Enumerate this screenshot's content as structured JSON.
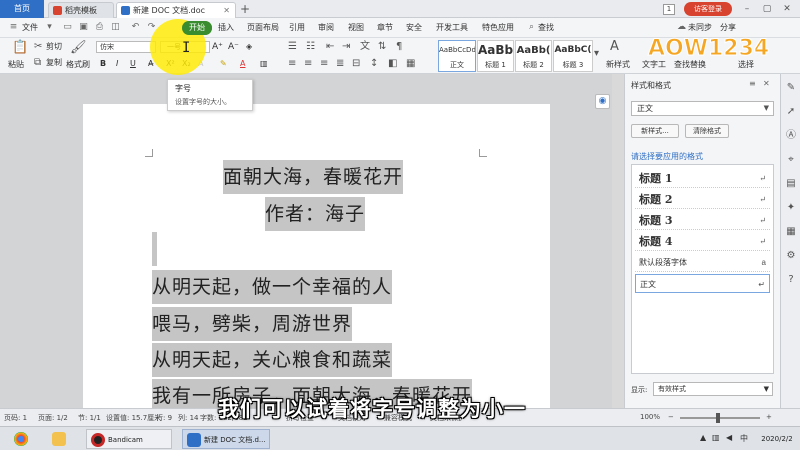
{
  "tabs": {
    "home_label": "首页",
    "items": [
      {
        "label": "稻壳模板",
        "active": false,
        "icon": "wps-logo-icon"
      },
      {
        "label": "新建 DOC 文档.doc",
        "active": true,
        "icon": "writer-doc-icon"
      }
    ],
    "add_label": "+",
    "page_count": "1",
    "login_label": "访客登录"
  },
  "menu": {
    "file_label": "文件",
    "items": [
      "开始",
      "插入",
      "页面布局",
      "引用",
      "审阅",
      "视图",
      "章节",
      "安全",
      "开发工具",
      "特色应用"
    ],
    "active": "开始",
    "search_label": "查找",
    "sync_label": "未同步",
    "share_label": "分享"
  },
  "ribbon": {
    "cut_label": "剪切",
    "copy_label": "复制",
    "format_painter_label": "格式刷",
    "paste_label": "粘贴",
    "font_name": "仿宋",
    "font_size": "一号",
    "bold_label": "B",
    "italic_label": "I",
    "underline_label": "U",
    "styles": [
      {
        "sample": "AaBbCcDd",
        "name": "正文"
      },
      {
        "sample": "AaBb",
        "name": "标题 1"
      },
      {
        "sample": "AaBb(",
        "name": "标题 2"
      },
      {
        "sample": "AaBbC(",
        "name": "标题 3"
      }
    ],
    "new_style_label": "新样式",
    "text_tools_label": "文字工",
    "find_replace_label": "查找替换",
    "select_label": "选择",
    "logo_text": "AOW1234"
  },
  "tooltip": {
    "title": "字号",
    "description": "设置字号的大小。"
  },
  "document": {
    "title": "面朝大海，春暖花开",
    "author": "作者：海子",
    "lines": [
      "从明天起，做一个幸福的人",
      "喂马，劈柴，周游世界",
      "从明天起，关心粮食和蔬菜",
      "我有一所房子，面朝大海，春暖花开"
    ]
  },
  "panel": {
    "title": "样式和格式",
    "current_style": "正文",
    "new_style_button": "新样式...",
    "clear_format_button": "清除格式",
    "apply_label": "请选择要应用的格式",
    "styles": [
      {
        "label": "标题 1",
        "kind": "heading"
      },
      {
        "label": "标题 2",
        "kind": "heading"
      },
      {
        "label": "标题 3",
        "kind": "heading"
      },
      {
        "label": "标题 4",
        "kind": "heading"
      },
      {
        "label": "默认段落字体",
        "kind": "small"
      },
      {
        "label": "正文",
        "kind": "selected"
      }
    ],
    "show_label": "显示:",
    "show_value": "有效样式"
  },
  "status": {
    "page": "页码: 1",
    "pages": "页面: 1/2",
    "section": "节: 1/1",
    "setting": "设置值: 15.7厘米",
    "row": "行: 9",
    "col": "列: 14",
    "words": "字数: 182/182",
    "spell_check": "拼写检查",
    "doc_check": "文档校对",
    "compat_mode": "兼容模式",
    "doc_unprotected": "文档未保护",
    "zoom": "100%"
  },
  "subtitle": "我们可以试着将字号调整为小一",
  "taskbar": {
    "apps": [
      {
        "label": "",
        "icon": "chrome-icon"
      },
      {
        "label": "",
        "icon": "folder-icon"
      },
      {
        "label": "Bandicam",
        "icon": "bandicam-icon"
      },
      {
        "label": "新建 DOC 文档.d...",
        "icon": "wps-writer-icon"
      }
    ],
    "tray_lang": "中",
    "clock_date": "2020/2/2"
  },
  "colors": {
    "accent_blue": "#2f6fc5",
    "active_green": "#3a8d2f",
    "login_red": "#d8432f",
    "selection_gray": "#c5c5c5",
    "highlight_yellow": "#ffeb00"
  }
}
